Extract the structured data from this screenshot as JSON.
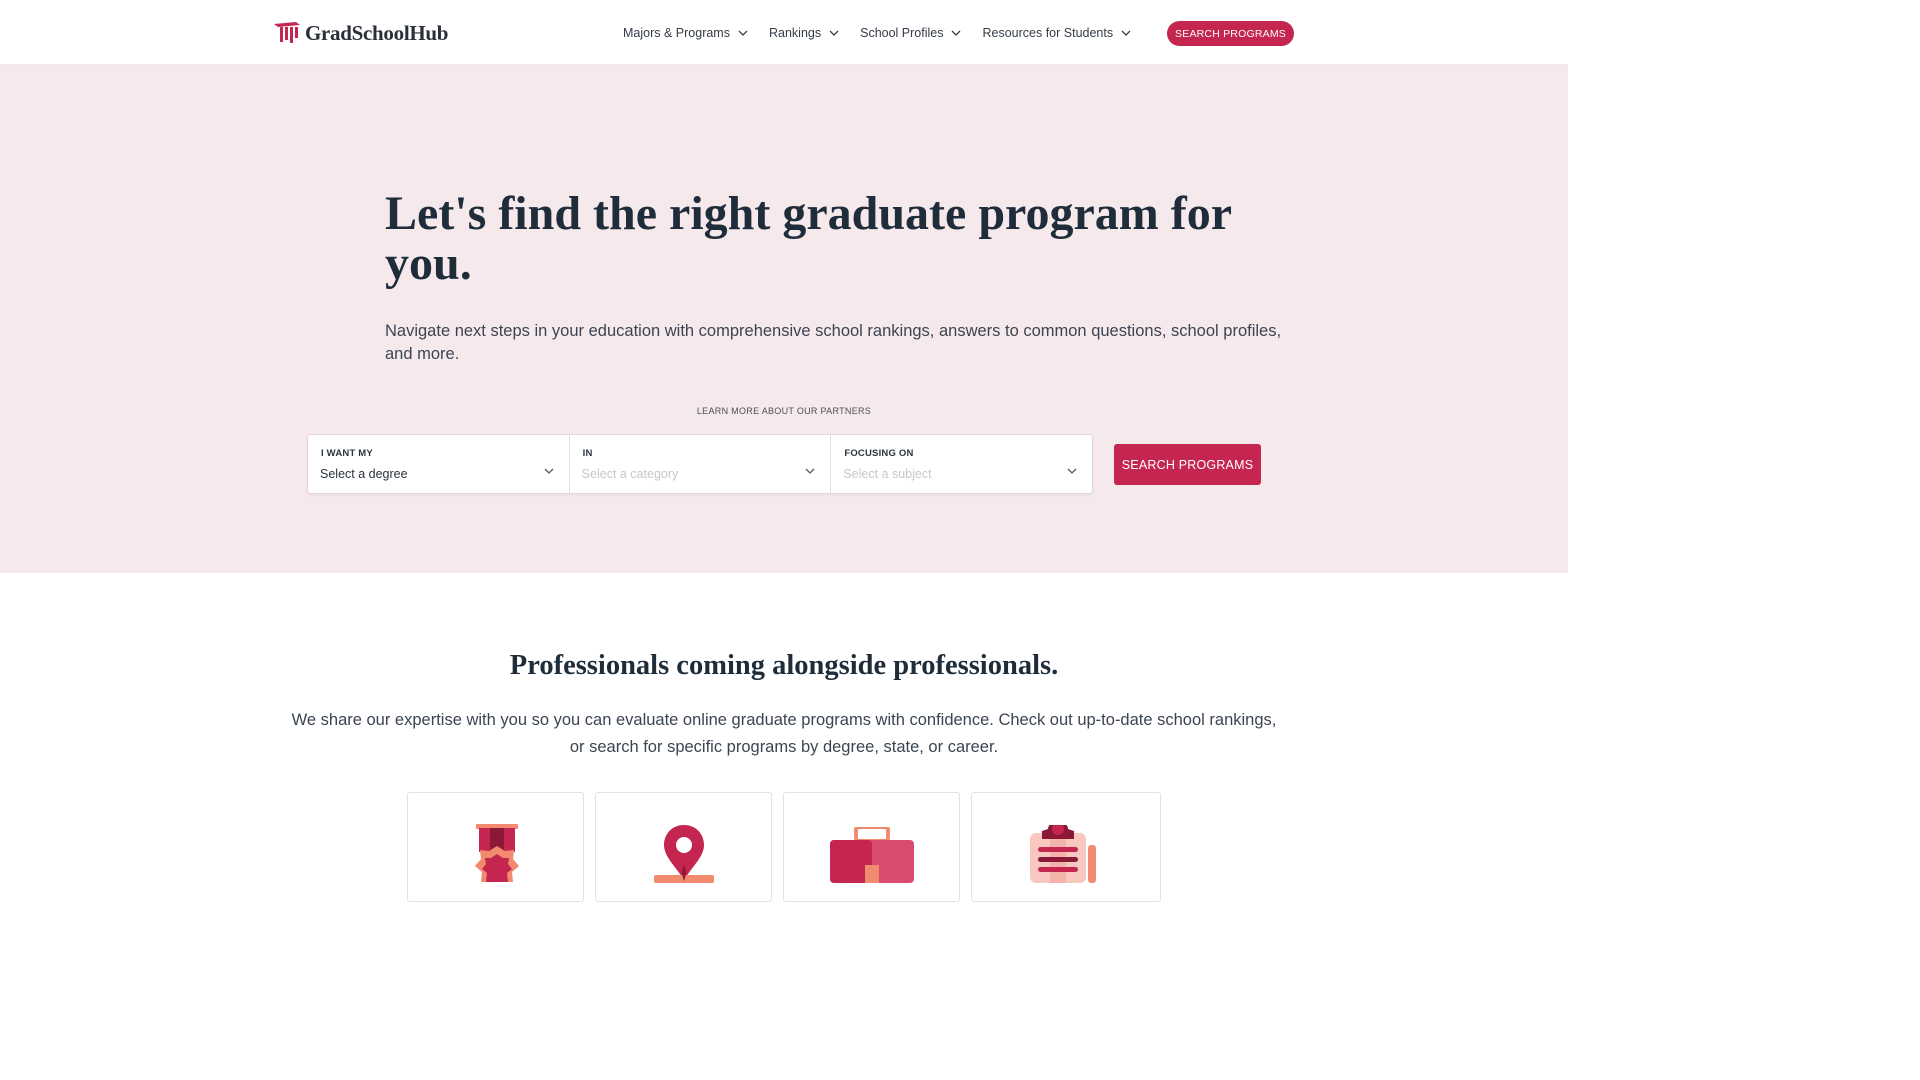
{
  "header": {
    "logo_text": "GradSchoolHub",
    "nav": [
      {
        "label": "Majors & Programs"
      },
      {
        "label": "Rankings"
      },
      {
        "label": "School Profiles"
      },
      {
        "label": "Resources for Students"
      }
    ],
    "cta_label": "SEARCH PROGRAMS"
  },
  "hero": {
    "title": "Let's find the right graduate program for you.",
    "subtitle": "Navigate next steps in your education with comprehensive school rankings, answers to common questions, school profiles, and more.",
    "partners_link": "LEARN MORE ABOUT OUR PARTNERS",
    "search": {
      "fields": [
        {
          "label": "I WANT MY",
          "value": "Select a degree"
        },
        {
          "label": "IN",
          "placeholder": "Select a category"
        },
        {
          "label": "FOCUSING ON",
          "placeholder": "Select a subject"
        }
      ],
      "button_label": "SEARCH PROGRAMS"
    }
  },
  "section": {
    "title": "Professionals coming alongside professionals.",
    "subtitle": "We share our expertise with you so you can evaluate online graduate programs with confidence. Check out up-to-date school rankings, or search for specific programs by degree, state, or career.",
    "cards": [
      {
        "icon": "award-ribbon-icon"
      },
      {
        "icon": "map-pin-icon"
      },
      {
        "icon": "briefcase-icon"
      },
      {
        "icon": "clipboard-icon"
      }
    ]
  },
  "colors": {
    "brand": "#c4264f",
    "hero_bg": "#f6e9eb",
    "heading": "#1f2d3b"
  }
}
